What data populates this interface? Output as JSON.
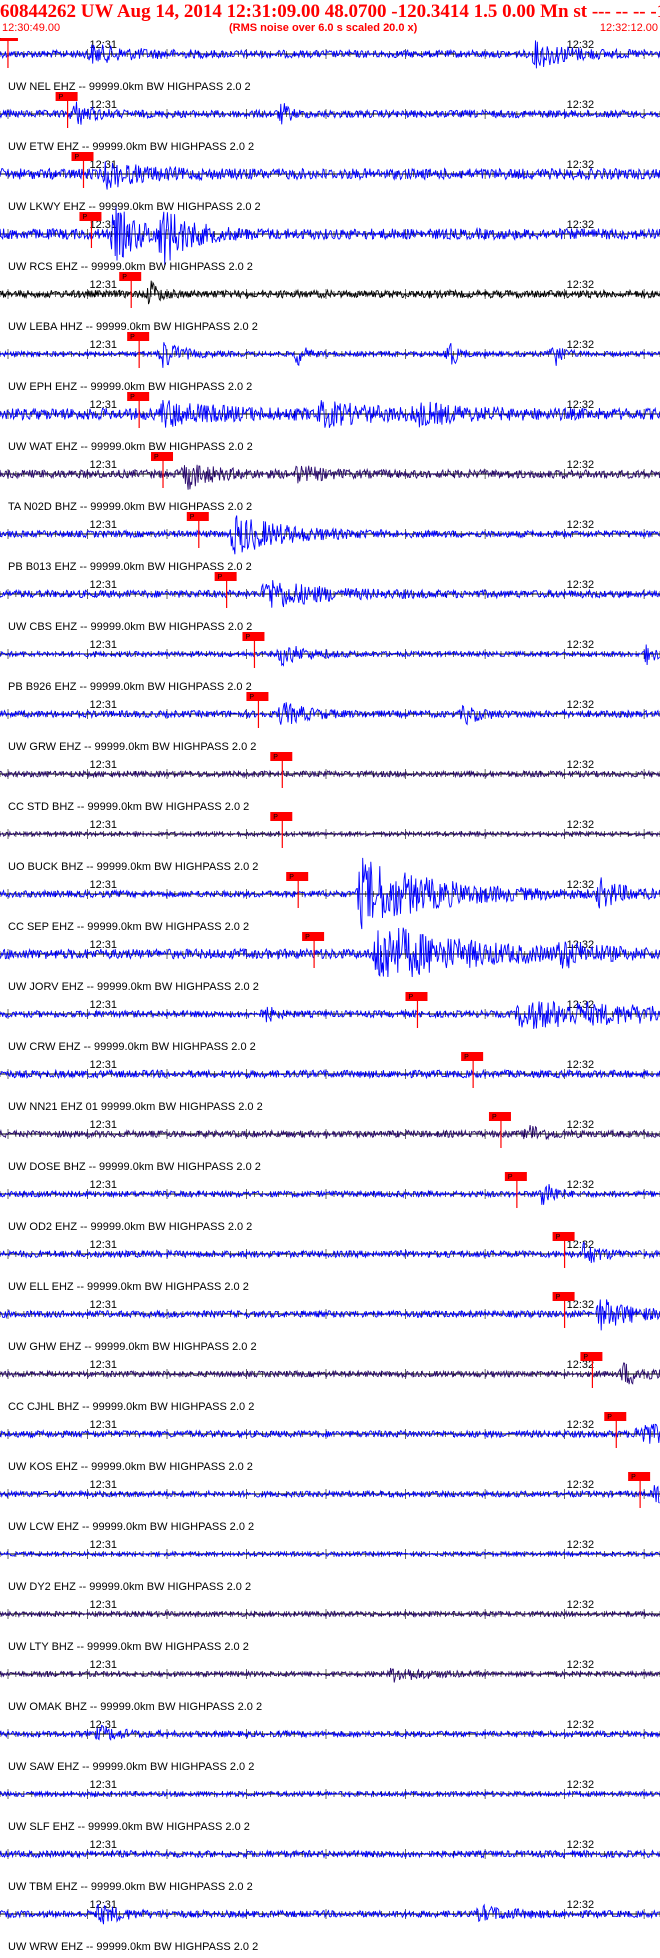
{
  "header": {
    "title": "60844262 UW Aug 14, 2014 12:31:09.00   48.0700 -120.3414  1.5 0.00 Mn st --- -- --  -1",
    "start_time": "12:30:49.00",
    "end_time": "12:32:12.00",
    "rms_note": "(RMS noise over 6.0 s scaled 20.0 x)"
  },
  "chart_data": {
    "type": "line",
    "time_start": "12:30:49.00",
    "time_end": "12:32:12.00",
    "minute_ticks": [
      {
        "label": "12:31",
        "t": 11
      },
      {
        "label": "12:32",
        "t": 71
      }
    ],
    "pick_label": "P",
    "traces": [
      {
        "label": "UW NEL EHZ -- 99999.0km BW  HIGHPASS  2.0  2",
        "color": "#0000ff",
        "pick": 1.0,
        "amp": 0.9,
        "events": [
          [
            11,
            1.8,
            5
          ],
          [
            67,
            3.0,
            4
          ]
        ]
      },
      {
        "label": "UW ETW EHZ -- 99999.0km BW  HIGHPASS  2.0  2",
        "color": "#0000ff",
        "pick": 8.5,
        "amp": 0.9,
        "events": [
          [
            9,
            2.5,
            2
          ],
          [
            35,
            2.2,
            1
          ]
        ]
      },
      {
        "label": "UW LKWY EHZ -- 99999.0km BW  HIGHPASS  2.0  2",
        "color": "#0000ff",
        "pick": 10.5,
        "amp": 1.3,
        "events": [
          [
            13,
            2.6,
            4
          ]
        ]
      },
      {
        "label": "UW RCS EHZ -- 99999.0km BW  HIGHPASS  2.0  2",
        "color": "#0000ff",
        "pick": 11.5,
        "amp": 1.3,
        "events": [
          [
            14,
            6.0,
            3
          ],
          [
            20,
            6.0,
            3
          ]
        ]
      },
      {
        "label": "UW LEBA HHZ -- 99999.0km BW  HIGHPASS  2.0  2",
        "color": "#000000",
        "pick": 16.5,
        "amp": 0.9,
        "events": [
          [
            18.5,
            3.0,
            1
          ]
        ]
      },
      {
        "label": "UW EPH EHZ -- 99999.0km BW  HIGHPASS  2.0  2",
        "color": "#0000ff",
        "pick": 17.5,
        "amp": 0.6,
        "events": [
          [
            20,
            3.5,
            2
          ],
          [
            37,
            2.5,
            1
          ],
          [
            56,
            3.5,
            1
          ],
          [
            69,
            4.0,
            1
          ]
        ]
      },
      {
        "label": "UW WAT EHZ -- 99999.0km BW  HIGHPASS  2.0  2",
        "color": "#0000ff",
        "pick": 17.5,
        "amp": 1.4,
        "events": [
          [
            20,
            2.5,
            6
          ],
          [
            40,
            2.2,
            6
          ],
          [
            52,
            1.8,
            5
          ]
        ]
      },
      {
        "label": "TA N02D BHZ -- 99999.0km BW  HIGHPASS  2.0  2",
        "color": "#2a0a6e",
        "pick": 20.5,
        "amp": 1.0,
        "events": [
          [
            23,
            3.0,
            3
          ],
          [
            37,
            1.5,
            3
          ]
        ]
      },
      {
        "label": "PB B013 EHZ -- 99999.0km BW  HIGHPASS  2.0  2",
        "color": "#0000ff",
        "pick": 25.0,
        "amp": 0.8,
        "events": [
          [
            29,
            4.5,
            6
          ]
        ]
      },
      {
        "label": "UW CBS EHZ -- 99999.0km BW  HIGHPASS  2.0  2",
        "color": "#0000ff",
        "pick": 28.5,
        "amp": 0.9,
        "events": [
          [
            33,
            3.5,
            6
          ]
        ]
      },
      {
        "label": "PB B926 EHZ -- 99999.0km BW  HIGHPASS  2.0  2",
        "color": "#0000ff",
        "pick": 32.0,
        "amp": 0.6,
        "events": [
          [
            35,
            2.5,
            3
          ],
          [
            81,
            2.5,
            1
          ]
        ]
      },
      {
        "label": "UW GRW EHZ -- 99999.0km BW  HIGHPASS  2.0  2",
        "color": "#0000ff",
        "pick": 32.5,
        "amp": 0.8,
        "events": [
          [
            35,
            2.5,
            3
          ],
          [
            58,
            2.0,
            2
          ]
        ]
      },
      {
        "label": "CC STD BHZ -- 99999.0km BW  HIGHPASS  2.0  2",
        "color": "#2a0a6e",
        "pick": 35.5,
        "amp": 0.7,
        "events": []
      },
      {
        "label": "UO BUCK BHZ -- 99999.0km BW  HIGHPASS  2.0  2",
        "color": "#2a0a6e",
        "pick": 35.5,
        "amp": 0.5,
        "events": []
      },
      {
        "label": "CC SEP EHZ -- 99999.0km BW  HIGHPASS  2.0  2",
        "color": "#0000ff",
        "pick": 37.5,
        "amp": 0.8,
        "events": [
          [
            45,
            8.0,
            9
          ],
          [
            75,
            3.0,
            3
          ]
        ]
      },
      {
        "label": "UW JORV EHZ -- 99999.0km BW  HIGHPASS  2.0  2",
        "color": "#0000ff",
        "pick": 39.5,
        "amp": 1.2,
        "events": [
          [
            47,
            7.0,
            10
          ],
          [
            70,
            2.2,
            4
          ]
        ]
      },
      {
        "label": "UW CRW EHZ -- 99999.0km BW  HIGHPASS  2.0  2",
        "color": "#0000ff",
        "pick": 52.5,
        "amp": 0.8,
        "events": [
          [
            33,
            1.8,
            1
          ],
          [
            65,
            3.0,
            22
          ]
        ]
      },
      {
        "label": "UW NN21 EHZ 01 99999.0km BW  HIGHPASS  2.0  2",
        "color": "#0000ff",
        "pick": 59.5,
        "amp": 0.9,
        "events": []
      },
      {
        "label": "UW DOSE BHZ -- 99999.0km BW  HIGHPASS  2.0  2",
        "color": "#2a0a6e",
        "pick": 63.0,
        "amp": 0.8,
        "events": [
          [
            66,
            2.0,
            2
          ]
        ]
      },
      {
        "label": "UW OD2 EHZ -- 99999.0km BW  HIGHPASS  2.0  2",
        "color": "#0000ff",
        "pick": 65.0,
        "amp": 0.7,
        "events": [
          [
            68,
            4.5,
            1
          ]
        ]
      },
      {
        "label": "UW ELL EHZ -- 99999.0km BW  HIGHPASS  2.0  2",
        "color": "#0000ff",
        "pick": 71.0,
        "amp": 0.8,
        "events": [
          [
            73,
            2.5,
            2
          ]
        ]
      },
      {
        "label": "UW GHW EHZ -- 99999.0km BW  HIGHPASS  2.0  2",
        "color": "#0000ff",
        "pick": 71.0,
        "amp": 0.8,
        "events": [
          [
            75,
            3.5,
            4
          ]
        ]
      },
      {
        "label": "CC CJHL BHZ -- 99999.0km BW  HIGHPASS  2.0  2",
        "color": "#2a0a6e",
        "pick": 74.5,
        "amp": 0.7,
        "events": [
          [
            78,
            2.5,
            3
          ]
        ]
      },
      {
        "label": "UW KOS EHZ -- 99999.0km BW  HIGHPASS  2.0  2",
        "color": "#0000ff",
        "pick": 77.5,
        "amp": 0.8,
        "events": [
          [
            80,
            3.0,
            3
          ]
        ]
      },
      {
        "label": "UW LCW EHZ -- 99999.0km BW  HIGHPASS  2.0  2",
        "color": "#0000ff",
        "pick": 80.5,
        "amp": 0.7,
        "events": [
          [
            82,
            2.0,
            2
          ]
        ]
      },
      {
        "label": "UW DY2 EHZ -- 99999.0km BW  HIGHPASS  2.0  2",
        "color": "#0000ff",
        "pick": null,
        "amp": 0.5,
        "events": []
      },
      {
        "label": "UW LTY BHZ -- 99999.0km BW  HIGHPASS  2.0  2",
        "color": "#2a0a6e",
        "pick": null,
        "amp": 0.6,
        "events": []
      },
      {
        "label": "UW OMAK BHZ -- 99999.0km BW  HIGHPASS  2.0  2",
        "color": "#2a0a6e",
        "pick": null,
        "amp": 0.6,
        "events": [
          [
            49,
            1.6,
            4
          ]
        ]
      },
      {
        "label": "UW SAW EHZ -- 99999.0km BW  HIGHPASS  2.0  2",
        "color": "#0000ff",
        "pick": null,
        "amp": 0.7,
        "events": [
          [
            12,
            1.5,
            3
          ]
        ]
      },
      {
        "label": "UW SLF EHZ -- 99999.0km BW  HIGHPASS  2.0  2",
        "color": "#0000ff",
        "pick": null,
        "amp": 0.6,
        "events": []
      },
      {
        "label": "UW TBM EHZ -- 99999.0km BW  HIGHPASS  2.0  2",
        "color": "#0000ff",
        "pick": null,
        "amp": 0.8,
        "events": []
      },
      {
        "label": "UW WRW EHZ -- 99999.0km BW  HIGHPASS  2.0  2",
        "color": "#0000ff",
        "pick": null,
        "amp": 0.8,
        "events": [
          [
            12,
            2.0,
            3
          ],
          [
            60,
            1.5,
            4
          ]
        ]
      }
    ]
  }
}
